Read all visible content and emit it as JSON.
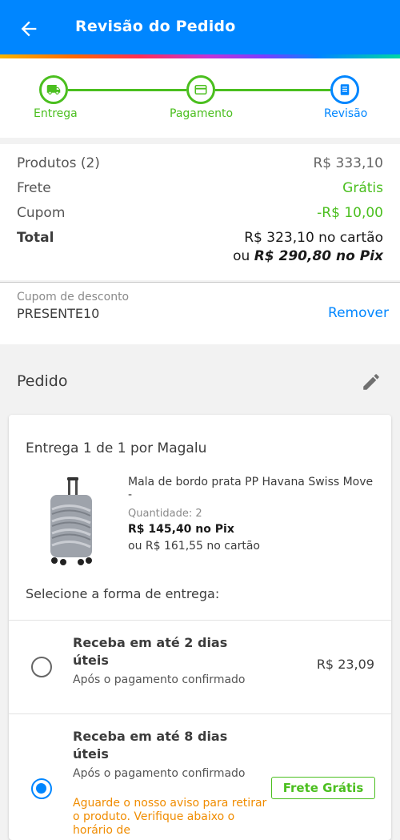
{
  "header": {
    "title": "Revisão do Pedido",
    "back_icon": "arrow-back-icon"
  },
  "stepper": {
    "steps": [
      {
        "label": "Entrega",
        "icon": "truck-icon",
        "state": "done"
      },
      {
        "label": "Pagamento",
        "icon": "card-icon",
        "state": "done"
      },
      {
        "label": "Revisão",
        "icon": "document-icon",
        "state": "current"
      }
    ]
  },
  "summary": {
    "products_label": "Produtos (2)",
    "products_value": "R$ 333,10",
    "shipping_label": "Frete",
    "shipping_value": "Grátis",
    "coupon_label": "Cupom",
    "coupon_value": "-R$ 10,00",
    "total_label": "Total",
    "total_card": "R$ 323,10 no cartão",
    "total_pix_prefix": "ou",
    "total_pix": "R$ 290,80 no Pix"
  },
  "coupon": {
    "label": "Cupom de desconto",
    "code": "PRESENTE10",
    "remove_label": "Remover"
  },
  "order": {
    "title": "Pedido",
    "delivery_title": "Entrega 1 de 1 por Magalu",
    "product": {
      "name": "Mala de bordo prata PP Havana Swiss Move -",
      "quantity_label": "Quantidade:",
      "quantity": "2",
      "price_pix": "R$ 145,40 no Pix",
      "price_card": "ou R$ 161,55 no cartão"
    },
    "select_label": "Selecione a forma de entrega:",
    "options": [
      {
        "title": "Receba em até 2 dias úteis",
        "subtitle": "Após o pagamento confirmado",
        "price": "R$ 23,09",
        "selected": false
      },
      {
        "title": "Receba em até 8 dias úteis",
        "subtitle": "Após o pagamento confirmado",
        "badge": "Frete Grátis",
        "warning": "Aguarde o nosso aviso para retirar o produto. Verifique abaixo o horário de",
        "selected": true
      }
    ]
  },
  "colors": {
    "primary": "#0086ff",
    "success": "#4bbf1f",
    "warning": "#f08c00"
  }
}
